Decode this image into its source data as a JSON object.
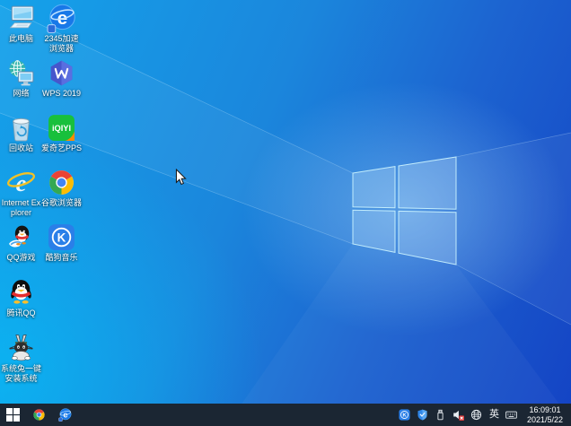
{
  "desktop": {
    "icons": [
      {
        "id": "this-pc",
        "icon": "this-pc",
        "label": "此电脑",
        "col": 0,
        "row": 0
      },
      {
        "id": "network",
        "icon": "network",
        "label": "网络",
        "col": 0,
        "row": 1
      },
      {
        "id": "recycle-bin",
        "icon": "recycle-bin",
        "label": "回收站",
        "col": 0,
        "row": 2
      },
      {
        "id": "internet-explorer",
        "icon": "ie",
        "label": "Internet Explorer",
        "col": 0,
        "row": 3
      },
      {
        "id": "qq-games",
        "icon": "qq-game",
        "label": "QQ游戏",
        "col": 0,
        "row": 4
      },
      {
        "id": "tencent-qq",
        "icon": "qq",
        "label": "腾讯QQ",
        "col": 0,
        "row": 5
      },
      {
        "id": "system-rabbit",
        "icon": "rabbit",
        "label": "系统兔一键安装系统",
        "col": 0,
        "row": 6
      },
      {
        "id": "2345-browser",
        "icon": "e2345",
        "label": "2345加速浏览器",
        "col": 1,
        "row": 0
      },
      {
        "id": "wps-2019",
        "icon": "wps",
        "label": "WPS 2019",
        "col": 1,
        "row": 1
      },
      {
        "id": "iqiyi-pps",
        "icon": "iqiyi",
        "label": "爱奇艺PPS",
        "col": 1,
        "row": 2
      },
      {
        "id": "chrome",
        "icon": "chrome",
        "label": "谷歌浏览器",
        "col": 1,
        "row": 3
      },
      {
        "id": "kugou-music",
        "icon": "kugou",
        "label": "酷狗音乐",
        "col": 1,
        "row": 4
      }
    ]
  },
  "taskbar": {
    "buttons": [
      {
        "id": "start",
        "icon": "start"
      },
      {
        "id": "chrome",
        "icon": "chrome"
      },
      {
        "id": "2345-browser",
        "icon": "e2345"
      }
    ],
    "tray": {
      "ime_label": "英",
      "icon_names": [
        "kugou-tray-icon",
        "security-shield-icon",
        "usb-device-icon",
        "volume-muted-icon",
        "network-globe-icon",
        "ime-indicator",
        "touch-keyboard-icon"
      ]
    },
    "clock": {
      "time": "16:09:01",
      "date": "2021/5/22"
    }
  },
  "colors": {
    "taskbar_bg": "#1b2633",
    "wallpaper_light": "#14a2ea",
    "wallpaper_mid": "#1b86dc",
    "wallpaper_deep": "#1443c4",
    "logo_edge": "#cdf5ff"
  }
}
